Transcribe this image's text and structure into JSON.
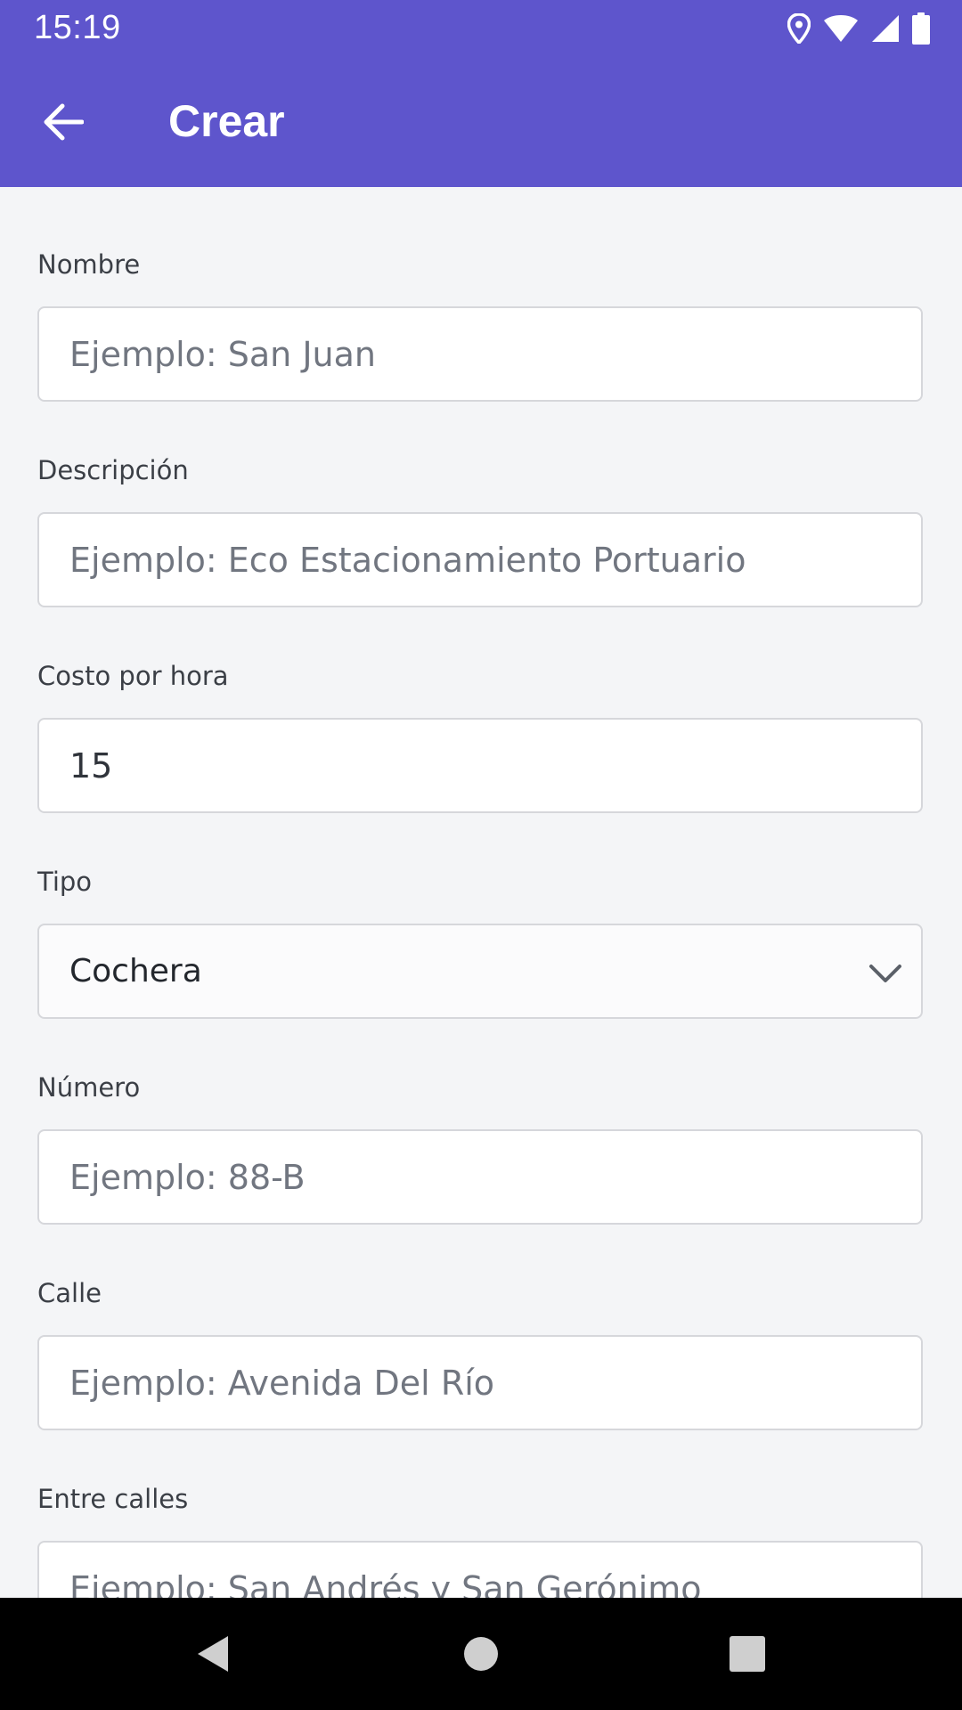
{
  "status_bar": {
    "time": "15:19",
    "icons": [
      "location-icon",
      "wifi-icon",
      "signal-icon",
      "battery-icon"
    ]
  },
  "app_bar": {
    "title": "Crear",
    "back_icon": "arrow-back-icon"
  },
  "form": {
    "nombre": {
      "label": "Nombre",
      "value": "",
      "placeholder": "Ejemplo: San Juan"
    },
    "descripcion": {
      "label": "Descripción",
      "value": "",
      "placeholder": "Ejemplo: Eco Estacionamiento Portuario"
    },
    "costo": {
      "label": "Costo por hora",
      "value": "15",
      "placeholder": ""
    },
    "tipo": {
      "label": "Tipo",
      "selected": "Cochera"
    },
    "numero": {
      "label": "Número",
      "value": "",
      "placeholder": "Ejemplo: 88-B"
    },
    "calle": {
      "label": "Calle",
      "value": "",
      "placeholder": "Ejemplo: Avenida Del Río"
    },
    "entre_calles": {
      "label": "Entre calles",
      "value": "",
      "placeholder": "Ejemplo: San Andrés y San Gerónimo"
    }
  },
  "nav_bar": {
    "icons": [
      "nav-back-icon",
      "nav-home-icon",
      "nav-recents-icon"
    ]
  },
  "colors": {
    "brand": "#5e55cc",
    "background": "#f4f5f7",
    "field_border": "#d6d7db",
    "label_text": "#3b3f46",
    "placeholder_text": "#717680"
  }
}
